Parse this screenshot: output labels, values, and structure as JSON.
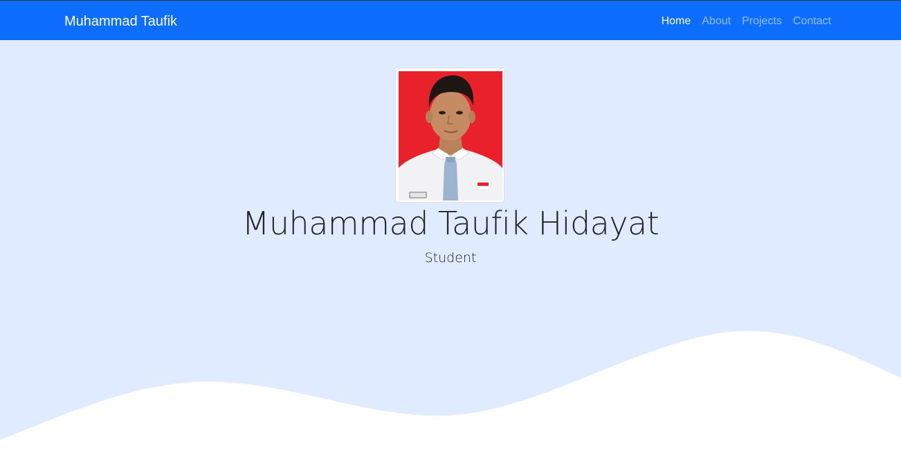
{
  "navbar": {
    "brand": "Muhammad Taufik",
    "links": [
      {
        "label": "Home",
        "active": true
      },
      {
        "label": "About",
        "active": false
      },
      {
        "label": "Projects",
        "active": false
      },
      {
        "label": "Contact",
        "active": false
      }
    ]
  },
  "hero": {
    "name": "Muhammad Taufik Hidayat",
    "role": "Student"
  },
  "colors": {
    "navbar": "#0d6efd",
    "hero_background": "#e0ebff",
    "wave": "#ffffff",
    "photo_background": "#e8212b"
  }
}
